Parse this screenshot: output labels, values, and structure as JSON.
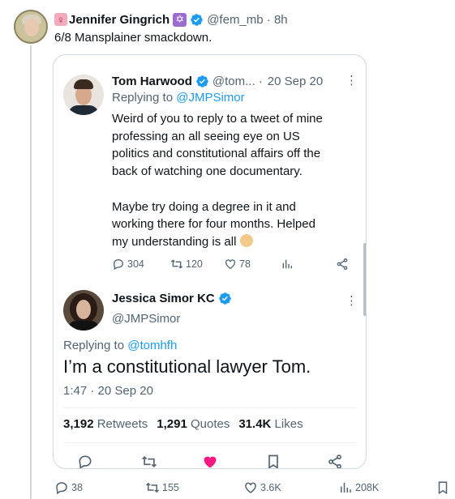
{
  "outer": {
    "name": "Jennifer Gingrich",
    "handle": "@fem_mb",
    "time": "8h",
    "text": "6/8 Mansplainer smackdown.",
    "badges": [
      "female-sign-icon",
      "star-of-david-icon",
      "verified-icon"
    ],
    "stats": {
      "replies": "38",
      "retweets": "155",
      "likes": "3.6K",
      "views": "208K"
    }
  },
  "quote": {
    "author": {
      "name": "Tom Harwood",
      "handle": "@tom...",
      "date": "20 Sep 20",
      "reply_prefix": "Replying to",
      "reply_to": "@JMPSimor",
      "body": "Weird of you to reply to a tweet of mine\nprofessing an all seeing eye on US\npolitics and constitutional affairs off the\nback of watching one documentary.\n\nMaybe try doing a degree in it and\nworking there for four months. Helped\nmy understanding is all",
      "replies": "304",
      "retweets": "120",
      "likes": "78"
    },
    "reply": {
      "name": "Jessica Simor KC",
      "handle": "@JMPSimor",
      "reply_prefix": "Replying to",
      "reply_to": "@tomhfh",
      "body": "I’m a constitutional lawyer Tom.",
      "time": "1:47 · 20 Sep 20",
      "retweets_count": "3,192",
      "retweets_label": "Retweets",
      "quotes_count": "1,291",
      "quotes_label": "Quotes",
      "likes_count": "31.4K",
      "likes_label": "Likes"
    }
  },
  "colors": {
    "accent": "#1d9bf0",
    "muted": "#536471",
    "like_pink": "#f91880",
    "border": "#cfd9de"
  }
}
